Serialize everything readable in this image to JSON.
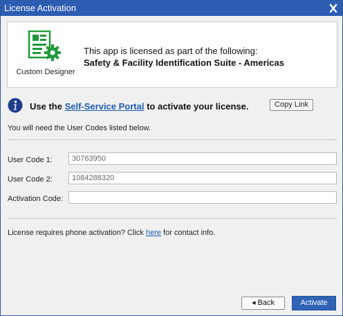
{
  "window": {
    "title": "License Activation",
    "close_glyph": "X",
    "title_bar_color": "#2d5db3"
  },
  "license_panel": {
    "product_icon": "custom-designer-icon",
    "product_name": "Custom Designer",
    "licensed_text": "This app is licensed as part of the following:",
    "suite_name": "Safety & Facility Identification Suite - Americas"
  },
  "instructions": {
    "info_icon": "info-icon",
    "prefix": "Use the ",
    "portal_link": "Self-Service Portal",
    "suffix": " to activate your license.",
    "copy_link_label": "Copy Link",
    "need_codes_text": "You will need the User Codes listed below."
  },
  "fields": {
    "user_code_1_label": "User Code 1:",
    "user_code_1_value": "30763950",
    "user_code_2_label": "User Code 2:",
    "user_code_2_value": "1084288320",
    "activation_code_label": "Activation Code:",
    "activation_code_value": ""
  },
  "phone": {
    "prefix": "License requires phone activation? Click ",
    "link": "here",
    "suffix": " for contact info."
  },
  "buttons": {
    "back_label": "◂ Back",
    "activate_label": "Activate"
  },
  "colors": {
    "accent": "#2f63b5",
    "link": "#1d5cb6",
    "icon_green": "#1f9a3a"
  }
}
